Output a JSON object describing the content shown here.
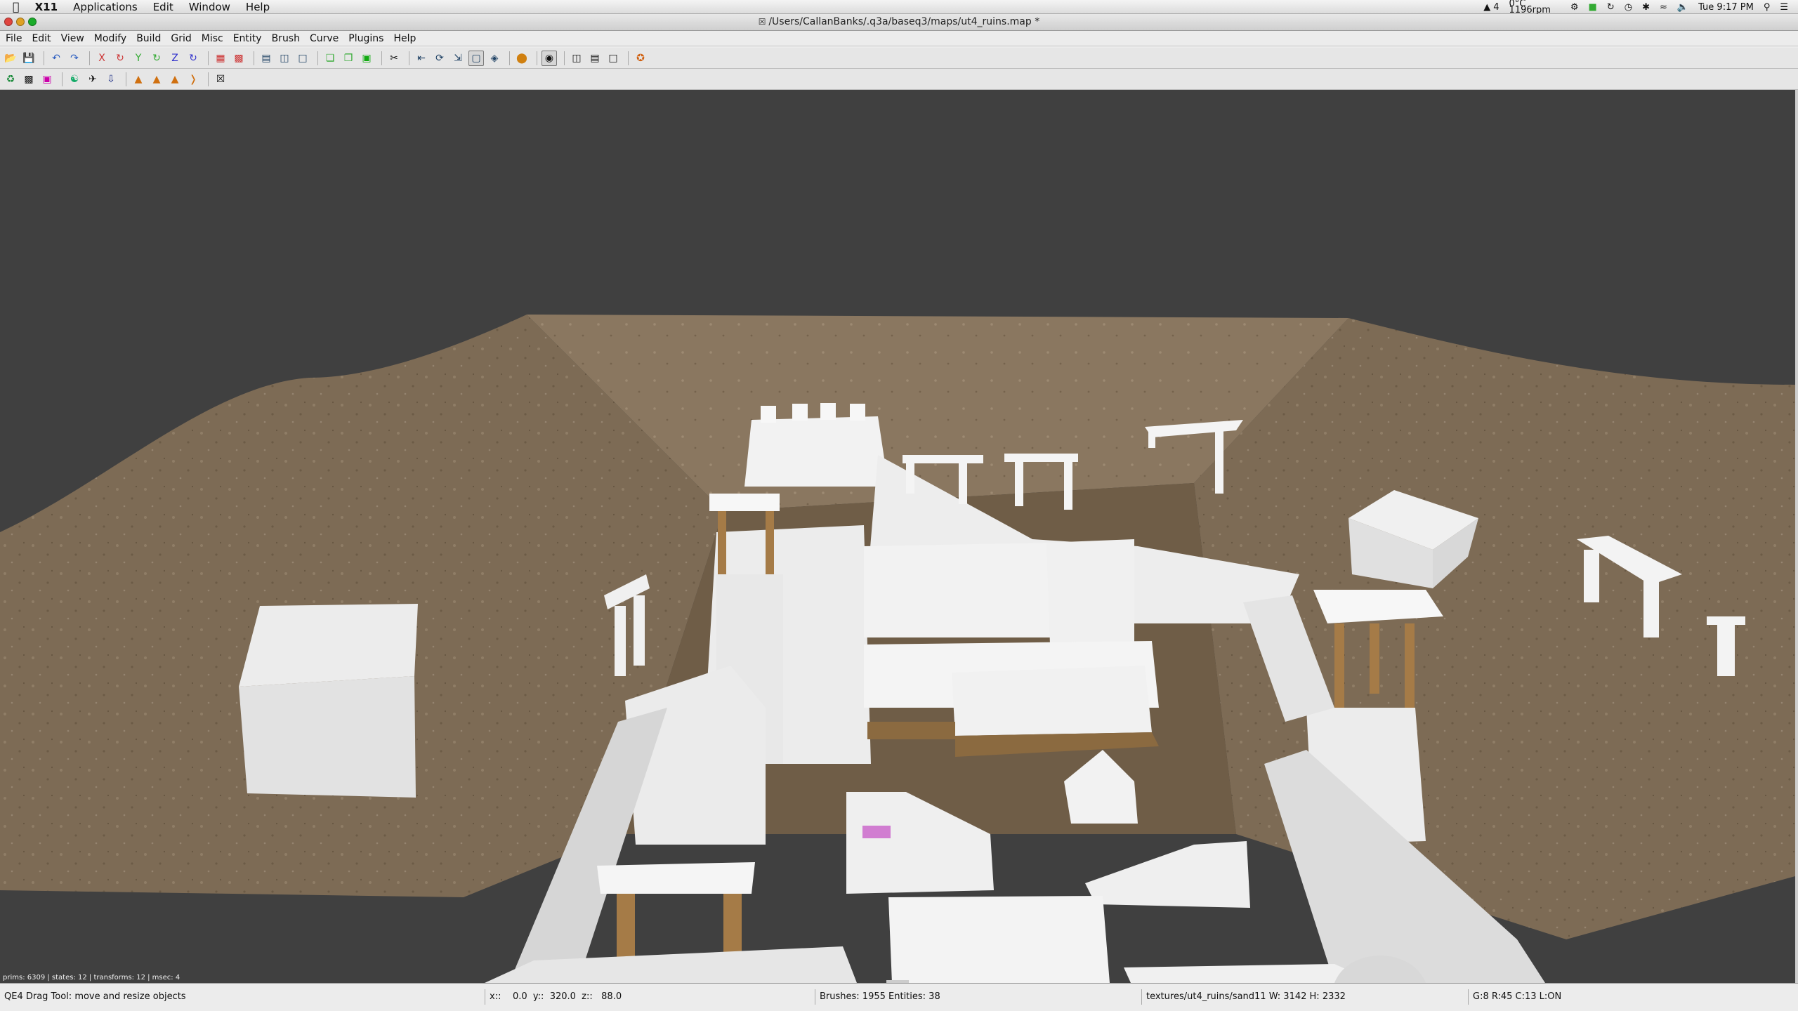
{
  "system_menubar": {
    "apple_icon": "apple-icon",
    "app_name": "X11",
    "items": [
      "Applications",
      "Edit",
      "Window",
      "Help"
    ],
    "status": {
      "adobe_count": "4",
      "weather_top": "0°C",
      "weather_bottom": "1196rpm",
      "clock": "Tue 9:17 PM"
    }
  },
  "window": {
    "title": "/Users/CallanBanks/.q3a/baseq3/maps/ut4_ruins.map *"
  },
  "menu": {
    "items": [
      "File",
      "Edit",
      "View",
      "Modify",
      "Build",
      "Grid",
      "Misc",
      "Entity",
      "Brush",
      "Curve",
      "Plugins",
      "Help"
    ]
  },
  "toolbar1": [
    "open-icon",
    "save-icon",
    "sep",
    "undo-icon",
    "redo-icon",
    "sep",
    "flip-x-icon",
    "rotate-x-icon",
    "flip-y-icon",
    "rotate-y-icon",
    "flip-z-icon",
    "rotate-z-icon",
    "sep",
    "csg-subtract-icon",
    "csg-merge-icon",
    "sep",
    "view-change-icon",
    "view-front-icon",
    "texture-view-icon",
    "sep",
    "cube-clip-icon",
    "camera-icon",
    "entity-icon",
    "sep",
    "clipper-icon",
    "sep",
    "select-icon",
    "rotate-tool-icon",
    "scale-tool-icon",
    "drag-tool-icon",
    "vertex-tool-icon",
    "sep",
    "patch-icon",
    "sep",
    "show-curves-icon",
    "sep",
    "view-layout-icon",
    "view-layout2-icon",
    "view-layout3-icon",
    "sep",
    "plugin-icon"
  ],
  "toolbar2": [
    "bobtoolz-icon",
    "brush-clean-icon",
    "splitter-icon",
    "sep",
    "prefab-icon",
    "ufo-icon",
    "arrow-down-icon",
    "sep",
    "cat-icon",
    "cat2-icon",
    "cat3-icon",
    "bracket-icon",
    "sep",
    "close-box-icon"
  ],
  "viewport": {
    "stats": "prims: 6309 | states: 12 | transforms: 12 | msec: 4"
  },
  "statusbar": {
    "tool": "QE4 Drag Tool: move and resize objects",
    "coords": "x::    0.0  y::  320.0  z::   88.0",
    "counts": "Brushes: 1955 Entities: 38",
    "texture": "textures/ut4_ruins/sand11 W: 3142 H: 2332",
    "grid": "G:8  R:45  C:13  L:ON"
  },
  "colors": {
    "viewport_bg": "#404040",
    "terrain": "#7c6a53",
    "brush_white": "#f2f2f2",
    "column_wood": "#a57b47"
  }
}
